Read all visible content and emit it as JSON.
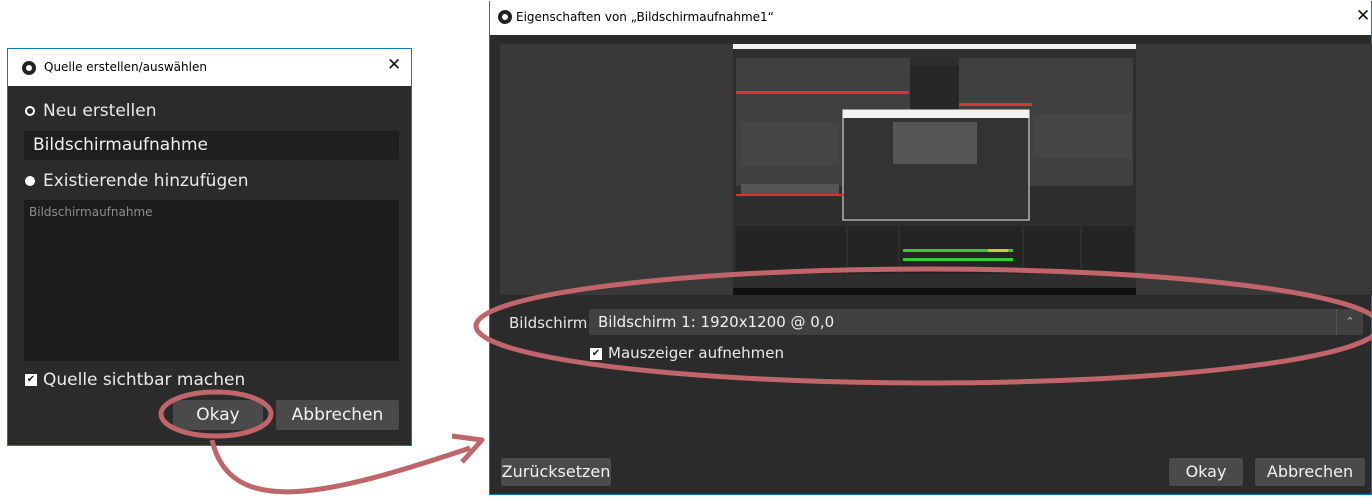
{
  "create_dialog": {
    "title": "Quelle erstellen/auswählen",
    "close_glyph": "✕",
    "option_new": "Neu erstellen",
    "name_value": "Bildschirmaufnahme",
    "option_existing": "Existierende hinzufügen",
    "existing_items": [
      "Bildschirmaufnahme"
    ],
    "visible_label": "Quelle sichtbar machen",
    "visible_checked": true,
    "ok_label": "Okay",
    "cancel_label": "Abbrechen"
  },
  "properties_dialog": {
    "title": "Eigenschaften von „Bildschirmaufnahme1“",
    "close_glyph": "✕",
    "screen_label": "Bildschirm",
    "screen_value": "Bildschirm 1: 1920x1200 @ 0,0",
    "cursor_label": "Mauszeiger aufnehmen",
    "cursor_checked": true,
    "reset_label": "Zurücksetzen",
    "ok_label": "Okay",
    "cancel_label": "Abbrechen"
  },
  "colors": {
    "annotation": "#c0666a",
    "window_bg": "#2b2b2b",
    "accent": "#0a79c9"
  }
}
